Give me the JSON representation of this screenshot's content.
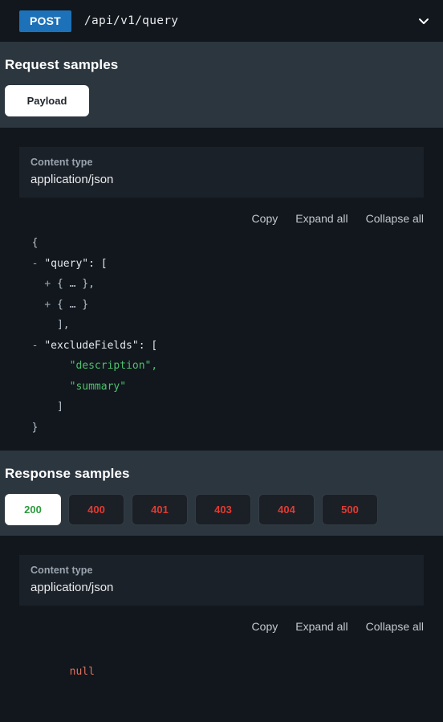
{
  "endpoint": {
    "method": "POST",
    "path": "/api/v1/query",
    "method_color": "#1d71b8",
    "collapse_icon": "chevron-down-icon"
  },
  "request_samples": {
    "title": "Request samples",
    "tabs": [
      {
        "label": "Payload",
        "active": true
      }
    ],
    "content_type": {
      "label": "Content type",
      "value": "application/json"
    },
    "toolbar": {
      "copy": "Copy",
      "expand_all": "Expand all",
      "collapse_all": "Collapse all"
    },
    "code_lines": [
      {
        "indent": 0,
        "toggle": "",
        "text": "{",
        "kind": "punct"
      },
      {
        "indent": 1,
        "toggle": "-",
        "text": "\"query\": [",
        "kind": "key"
      },
      {
        "indent": 2,
        "toggle": "+",
        "text": "{ … },",
        "kind": "punct"
      },
      {
        "indent": 2,
        "toggle": "+",
        "text": "{ … }",
        "kind": "punct"
      },
      {
        "indent": 2,
        "toggle": "",
        "text": "],",
        "kind": "punct"
      },
      {
        "indent": 1,
        "toggle": "-",
        "text": "\"excludeFields\": [",
        "kind": "key"
      },
      {
        "indent": 3,
        "toggle": "",
        "text": "\"description\",",
        "kind": "string"
      },
      {
        "indent": 3,
        "toggle": "",
        "text": "\"summary\"",
        "kind": "string"
      },
      {
        "indent": 2,
        "toggle": "",
        "text": "]",
        "kind": "punct"
      },
      {
        "indent": 0,
        "toggle": "",
        "text": "}",
        "kind": "punct"
      }
    ]
  },
  "response_samples": {
    "title": "Response samples",
    "status_tabs": [
      {
        "label": "200",
        "active": true,
        "color": "#2c9b3f"
      },
      {
        "label": "400",
        "active": false,
        "color": "#e23b33"
      },
      {
        "label": "401",
        "active": false,
        "color": "#e23b33"
      },
      {
        "label": "403",
        "active": false,
        "color": "#e23b33"
      },
      {
        "label": "404",
        "active": false,
        "color": "#e23b33"
      },
      {
        "label": "500",
        "active": false,
        "color": "#e23b33"
      }
    ],
    "content_type": {
      "label": "Content type",
      "value": "application/json"
    },
    "toolbar": {
      "copy": "Copy",
      "expand_all": "Expand all",
      "collapse_all": "Collapse all"
    },
    "body": "null"
  }
}
